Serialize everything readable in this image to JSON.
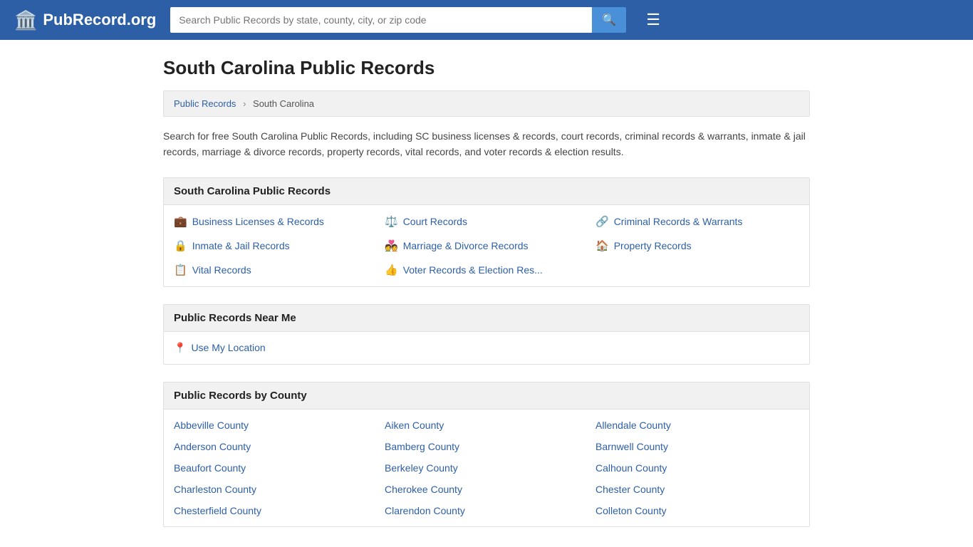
{
  "header": {
    "logo_text": "PubRecord.org",
    "search_placeholder": "Search Public Records by state, county, city, or zip code",
    "search_icon": "🔍",
    "menu_icon": "☰"
  },
  "page": {
    "title": "South Carolina Public Records",
    "breadcrumb": {
      "home": "Public Records",
      "current": "South Carolina"
    },
    "description": "Search for free South Carolina Public Records, including SC business licenses & records, court records, criminal records & warrants, inmate & jail records, marriage & divorce records, property records, vital records, and voter records & election results."
  },
  "sc_records": {
    "section_title": "South Carolina Public Records",
    "items": [
      {
        "icon": "💼",
        "label": "Business Licenses & Records"
      },
      {
        "icon": "⚖️",
        "label": "Court Records"
      },
      {
        "icon": "🔗",
        "label": "Criminal Records & Warrants"
      },
      {
        "icon": "🔒",
        "label": "Inmate & Jail Records"
      },
      {
        "icon": "💑",
        "label": "Marriage & Divorce Records"
      },
      {
        "icon": "🏠",
        "label": "Property Records"
      },
      {
        "icon": "📋",
        "label": "Vital Records"
      },
      {
        "icon": "👍",
        "label": "Voter Records & Election Res..."
      }
    ]
  },
  "near_me": {
    "section_title": "Public Records Near Me",
    "location_label": "Use My Location",
    "location_icon": "📍"
  },
  "by_county": {
    "section_title": "Public Records by County",
    "counties": [
      "Abbeville County",
      "Aiken County",
      "Allendale County",
      "Anderson County",
      "Bamberg County",
      "Barnwell County",
      "Beaufort County",
      "Berkeley County",
      "Calhoun County",
      "Charleston County",
      "Cherokee County",
      "Chester County",
      "Chesterfield County",
      "Clarendon County",
      "Colleton County"
    ]
  }
}
